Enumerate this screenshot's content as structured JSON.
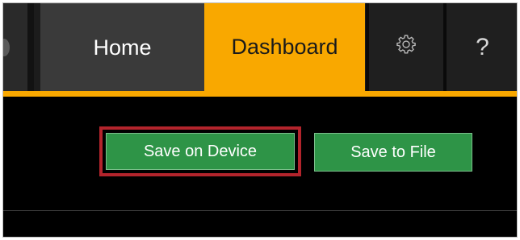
{
  "colors": {
    "accent": "#f9a800",
    "nav_background": "#1c1c1c",
    "content_background": "#000000",
    "button_green": "#2e9447",
    "highlight_red": "#b3242c"
  },
  "nav": {
    "tabs": [
      {
        "label": "Home",
        "active": false
      },
      {
        "label": "Dashboard",
        "active": true
      },
      {
        "icon": "gear-icon",
        "active": false
      },
      {
        "label": "?",
        "active": false
      }
    ]
  },
  "actions": {
    "save_device_label": "Save on Device",
    "save_file_label": "Save to File",
    "highlighted": "Save on Device"
  }
}
